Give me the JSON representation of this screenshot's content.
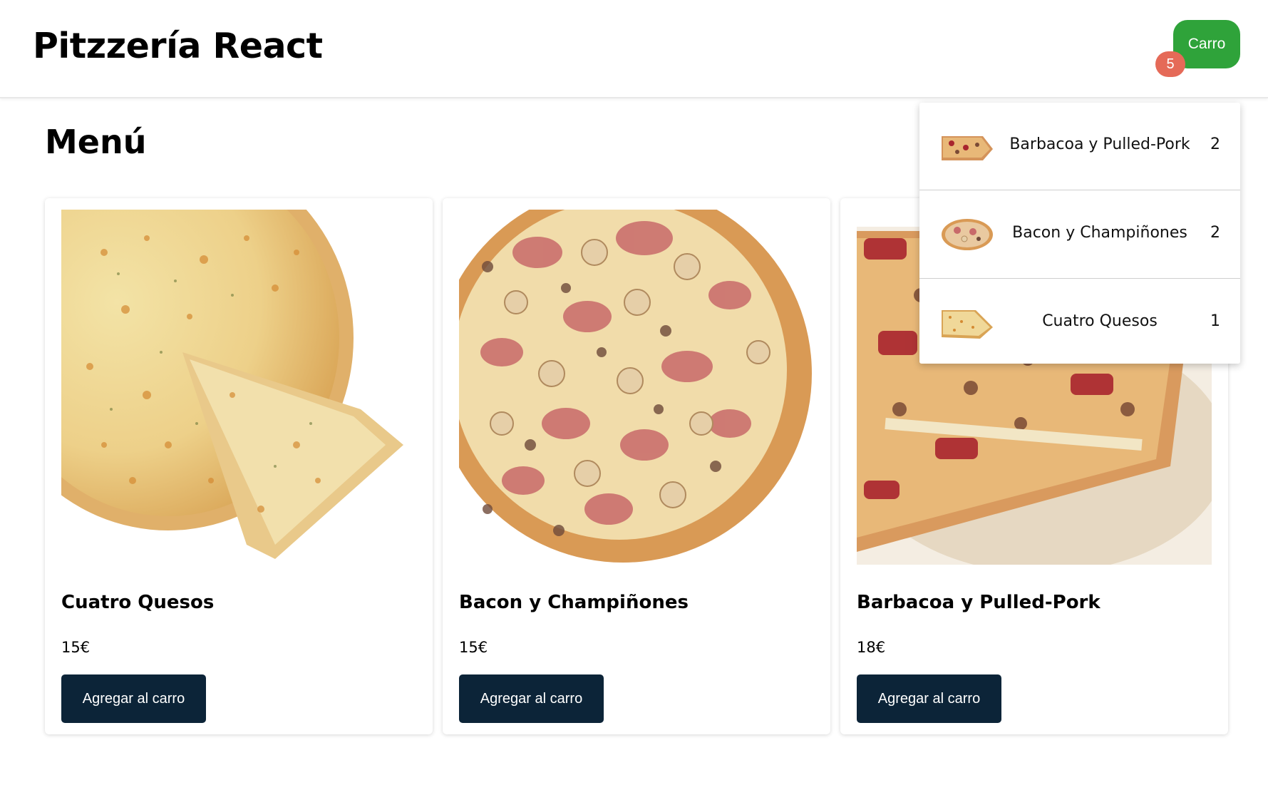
{
  "header": {
    "title": "Pitzzería React",
    "cart_label": "Carro",
    "cart_count": "5"
  },
  "menu": {
    "title": "Menú",
    "add_label": "Agregar al carro",
    "items": [
      {
        "name": "Cuatro Quesos",
        "price": "15€",
        "image": "four-cheese-pizza-image"
      },
      {
        "name": "Bacon y Champiñones",
        "price": "15€",
        "image": "bacon-mushroom-pizza-image"
      },
      {
        "name": "Barbacoa y Pulled-Pork",
        "price": "18€",
        "image": "bbq-pulled-pork-pizza-image"
      }
    ]
  },
  "cart": {
    "items": [
      {
        "name": "Barbacoa y Pulled-Pork",
        "qty": "2",
        "thumb": "bbq-pulled-pork-thumbnail"
      },
      {
        "name": "Bacon y Champiñones",
        "qty": "2",
        "thumb": "bacon-mushroom-thumbnail"
      },
      {
        "name": "Cuatro Quesos",
        "qty": "1",
        "thumb": "four-cheese-thumbnail"
      }
    ]
  },
  "colors": {
    "cart_button": "#2fa33a",
    "cart_badge": "#e56a58",
    "add_button": "#0c2438"
  }
}
